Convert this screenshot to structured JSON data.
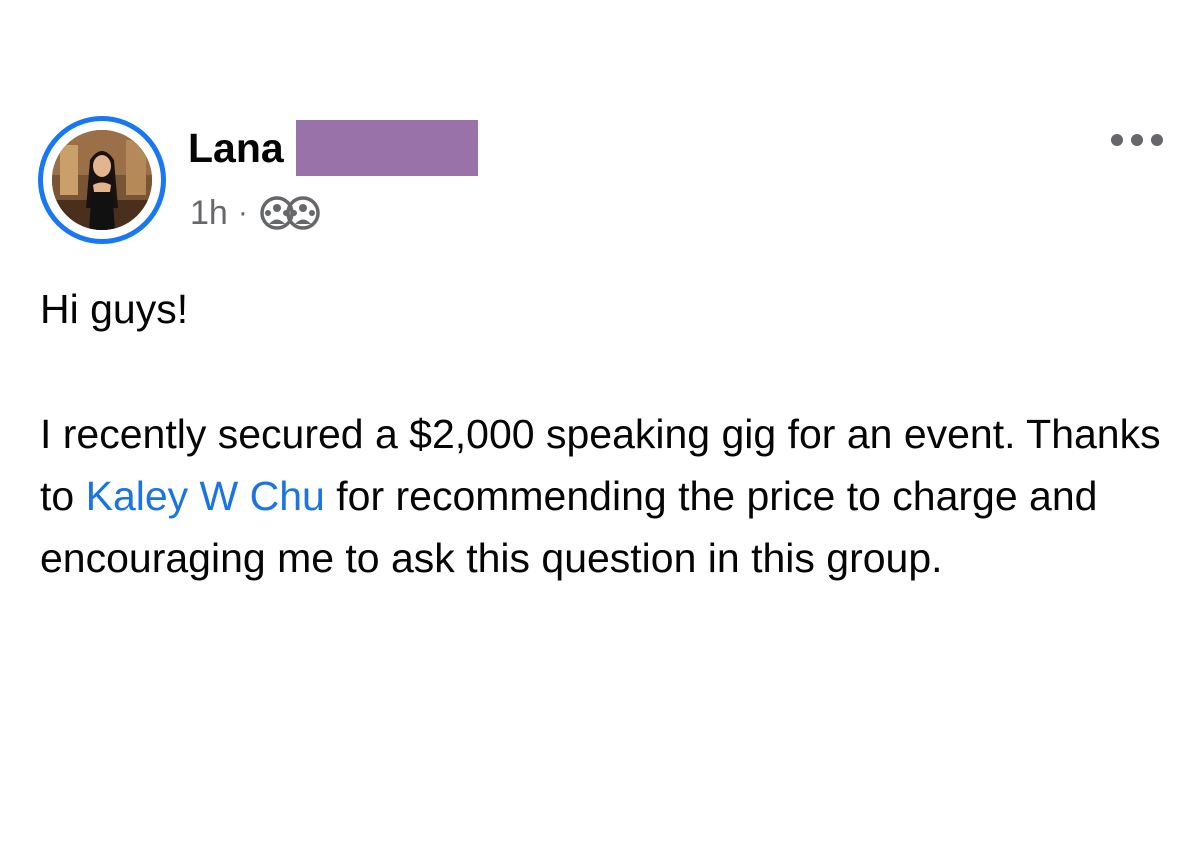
{
  "post": {
    "author": {
      "first_name": "Lana",
      "surname_redacted": true
    },
    "timestamp": "1h",
    "separator": "·",
    "audience_icon": "group-members-icon",
    "more_icon": "more-options-icon",
    "body": {
      "greeting": "Hi guys!",
      "paragraph": {
        "before_mention": "I recently secured a $2,000 speaking gig for an event. Thanks to ",
        "mention": "Kaley W Chu",
        "after_mention": " for recommending the price to charge and encouraging me to ask this question in this group."
      }
    }
  },
  "colors": {
    "avatar_ring": "#1877f2",
    "mention": "#1b74e4",
    "redaction": "#9872a9",
    "meta_text": "#65676b"
  }
}
